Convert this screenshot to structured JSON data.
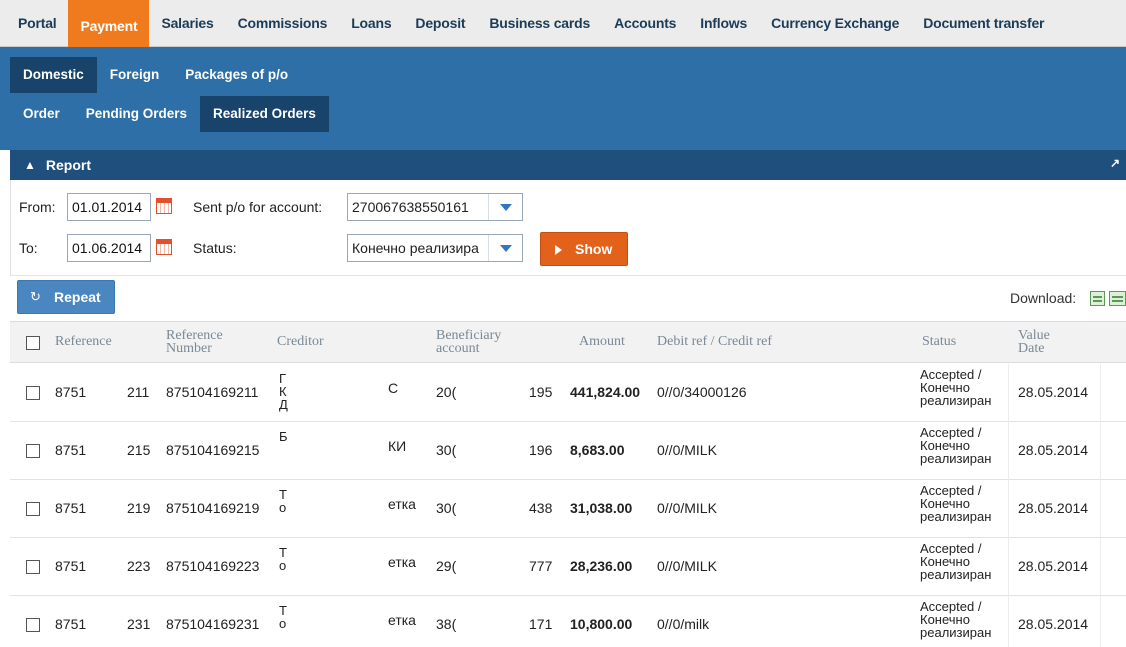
{
  "topnav": [
    "Portal",
    "Payment",
    "Salaries",
    "Commissions",
    "Loans",
    "Deposit",
    "Business cards",
    "Accounts",
    "Inflows",
    "Currency Exchange",
    "Document transfer"
  ],
  "topnav_active": "Payment",
  "subnav1": [
    "Domestic",
    "Foreign",
    "Packages of p/o"
  ],
  "subnav1_active": "Domestic",
  "subnav2": [
    "Order",
    "Pending Orders",
    "Realized Orders"
  ],
  "subnav2_active": "Realized Orders",
  "report": {
    "title": "Report"
  },
  "form": {
    "from_label": "From:",
    "from_value": "01.01.2014",
    "to_label": "To:",
    "to_value": "01.06.2014",
    "account_label": "Sent p/o for account:",
    "account_value": "270067638550161",
    "status_label": "Status:",
    "status_value": "Конечно реализира",
    "show_label": "Show"
  },
  "toolbar": {
    "repeat_label": "Repeat",
    "download_label": "Download:"
  },
  "table": {
    "headers": {
      "reference": "Reference",
      "reference_number_1": "Reference",
      "reference_number_2": "Number",
      "creditor": "Creditor",
      "beneficiary_1": "Beneficiary",
      "beneficiary_2": "account",
      "amount": "Amount",
      "debit_credit": "Debit ref / Credit ref",
      "status": "Status",
      "value_date_1": "Value",
      "value_date_2": "Date"
    },
    "rows": [
      {
        "ref_a": "8751",
        "ref_b": "211",
        "ref_number": "875104169211",
        "cred_a": "Г К Д",
        "cred_b": "С",
        "benef_a": "20(",
        "benef_b": "195",
        "amount": "441,824.00",
        "debit_credit": "0//0/34000126",
        "status_1": "Accepted /",
        "status_2": "Конечно",
        "status_3": "реализиран",
        "value_date": "28.05.2014"
      },
      {
        "ref_a": "8751",
        "ref_b": "215",
        "ref_number": "875104169215",
        "cred_a": "Б",
        "cred_b": "КИ",
        "benef_a": "30(",
        "benef_b": "196",
        "amount": "8,683.00",
        "debit_credit": "0//0/MILK",
        "status_1": "Accepted /",
        "status_2": "Конечно",
        "status_3": "реализиран",
        "value_date": "28.05.2014"
      },
      {
        "ref_a": "8751",
        "ref_b": "219",
        "ref_number": "875104169219",
        "cred_a": "Т о",
        "cred_b": "етка",
        "benef_a": "30(",
        "benef_b": "438",
        "amount": "31,038.00",
        "debit_credit": "0//0/MILK",
        "status_1": "Accepted /",
        "status_2": "Конечно",
        "status_3": "реализиран",
        "value_date": "28.05.2014"
      },
      {
        "ref_a": "8751",
        "ref_b": "223",
        "ref_number": "875104169223",
        "cred_a": "Т о",
        "cred_b": "етка",
        "benef_a": "29(",
        "benef_b": "777",
        "amount": "28,236.00",
        "debit_credit": "0//0/MILK",
        "status_1": "Accepted /",
        "status_2": "Конечно",
        "status_3": "реализиран",
        "value_date": "28.05.2014"
      },
      {
        "ref_a": "8751",
        "ref_b": "231",
        "ref_number": "875104169231",
        "cred_a": "Т о",
        "cred_b": "етка",
        "benef_a": "38(",
        "benef_b": "171",
        "amount": "10,800.00",
        "debit_credit": "0//0/milk",
        "status_1": "Accepted /",
        "status_2": "Конечно",
        "status_3": "реализиран",
        "value_date": "28.05.2014"
      }
    ]
  },
  "colors": {
    "accent": "#f07b1e",
    "blue": "#2d6fa6",
    "dark_blue": "#1e4f7d",
    "show_button": "#e2621b",
    "repeat_button": "#4a86bf"
  }
}
